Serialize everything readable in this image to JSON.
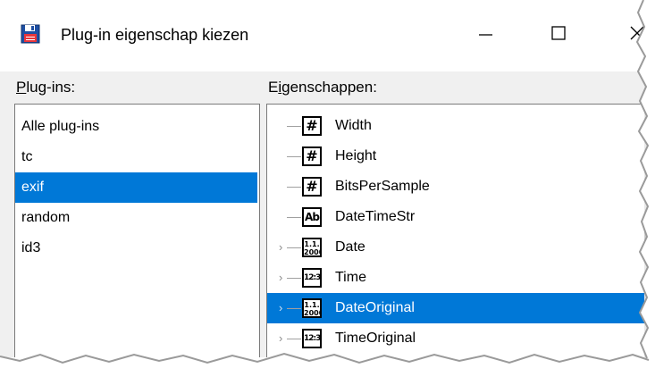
{
  "window": {
    "title": "Plug-in eigenschap kiezen",
    "icon": "floppy-disk-icon",
    "controls": [
      "minimize-icon",
      "maximize-icon",
      "close-icon"
    ]
  },
  "plugins": {
    "label_accel": "P",
    "label_rest": "lug-ins:",
    "items": [
      {
        "label": "Alle plug-ins",
        "selected": false
      },
      {
        "label": "tc",
        "selected": false
      },
      {
        "label": "exif",
        "selected": true
      },
      {
        "label": "random",
        "selected": false
      },
      {
        "label": "id3",
        "selected": false
      }
    ]
  },
  "properties": {
    "label_pre": "E",
    "label_accel": "i",
    "label_rest": "genschappen:",
    "items": [
      {
        "name": "Width",
        "type_icon": "number-icon",
        "glyph": "#",
        "expandable": false,
        "selected": false
      },
      {
        "name": "Height",
        "type_icon": "number-icon",
        "glyph": "#",
        "expandable": false,
        "selected": false
      },
      {
        "name": "BitsPerSample",
        "type_icon": "number-icon",
        "glyph": "#",
        "expandable": false,
        "selected": false
      },
      {
        "name": "DateTimeStr",
        "type_icon": "text-icon",
        "glyph": "Ab",
        "expandable": false,
        "selected": false
      },
      {
        "name": "Date",
        "type_icon": "date-icon",
        "glyph": "1.1. 2000",
        "expandable": true,
        "selected": false
      },
      {
        "name": "Time",
        "type_icon": "time-icon",
        "glyph": "12:35",
        "expandable": true,
        "selected": false
      },
      {
        "name": "DateOriginal",
        "type_icon": "date-icon",
        "glyph": "1.1. 2000",
        "expandable": true,
        "selected": true
      },
      {
        "name": "TimeOriginal",
        "type_icon": "time-icon",
        "glyph": "12:35",
        "expandable": true,
        "selected": false
      }
    ]
  },
  "colors": {
    "selection": "#0078d7",
    "window_bg": "#f0f0f0",
    "titlebar_bg": "#ffffff"
  }
}
